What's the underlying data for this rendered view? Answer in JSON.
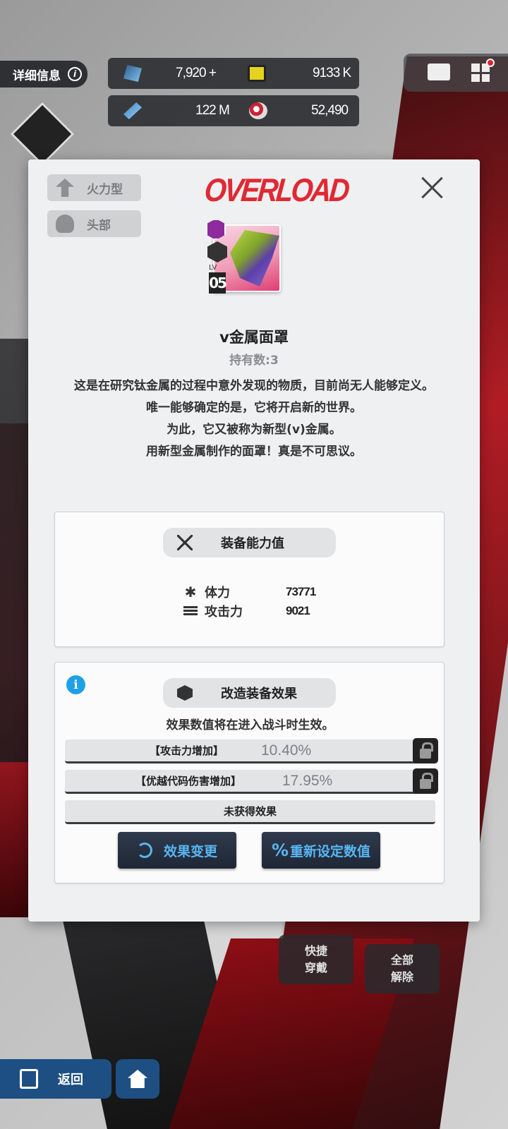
{
  "hud": {
    "info_label": "详细信息",
    "info_glyph": "i",
    "resources": {
      "gems": "7,920 +",
      "credits": "9133 K",
      "mats": "122 M",
      "orbs": "52,490"
    }
  },
  "modal": {
    "tags": {
      "class": "火力型",
      "slot": "头部"
    },
    "logo": "OVERLOAD",
    "item": {
      "lv_label": "LV",
      "lv_value": "05",
      "name": "v金属面罩",
      "held": "持有数:3",
      "description": [
        "这是在研究钛金属的过程中意外发现的物质，目前尚无人能够定义。",
        "唯一能够确定的是，它将开启新的世界。",
        "为此，它又被称为新型(v)金属。",
        "用新型金属制作的面罩！真是不可思议。"
      ]
    },
    "stats": {
      "title": "装备能力值",
      "rows": [
        {
          "icon": "asterisk-icon",
          "label": "体力",
          "value": "73771"
        },
        {
          "icon": "ammo-icon",
          "label": "攻击力",
          "value": "9021"
        }
      ]
    },
    "effects": {
      "title": "改造装备效果",
      "note": "效果数值将在进入战斗时生效。",
      "rows": [
        {
          "label": "【攻击力增加】",
          "value": "10.40%",
          "locked": true
        },
        {
          "label": "【优越代码伤害增加】",
          "value": "17.95%",
          "locked": true
        },
        {
          "label": "未获得效果",
          "value": "",
          "locked": false
        }
      ],
      "change_label": "效果变更",
      "reset_label": "重新设定数值",
      "reset_glyph": "%"
    }
  },
  "bottom": {
    "back_label": "返回",
    "quick_equip": [
      "快捷",
      "穿戴"
    ],
    "remove_all": [
      "全部",
      "解除"
    ]
  },
  "colors": {
    "logo_red": "#e02934",
    "accent_blue": "#58b6f2",
    "info_blue": "#1ea0e6"
  }
}
